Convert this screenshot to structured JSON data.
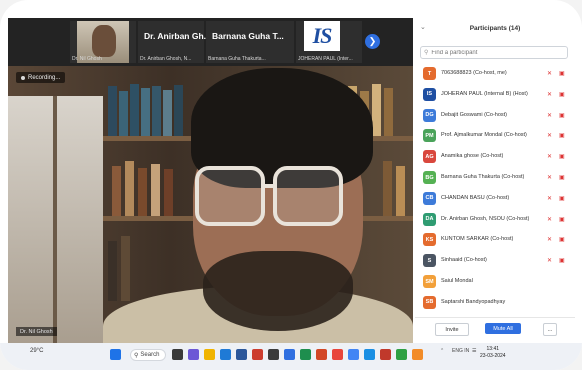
{
  "meeting": {
    "thumbnails": [
      {
        "name_overlay": "",
        "label": "Dr. Nil Ghosh"
      },
      {
        "name_overlay": "Dr. Anirban Gh...",
        "label": "Dr. Anirban Ghosh, N..."
      },
      {
        "name_overlay": "Barnana Guha T...",
        "label": "Barnana Guha Thakurta..."
      },
      {
        "name_overlay": "",
        "label": "JOHERAN PAUL (Inter..."
      }
    ],
    "recording_label": "Recording...",
    "self_label": "Dr. Nil Ghosh"
  },
  "participants_panel": {
    "title": "Participants (14)",
    "search_placeholder": "Find a participant",
    "participants": [
      {
        "initials": "T",
        "name": "7063688823 (Co-host, me)",
        "color": "#e46b2e"
      },
      {
        "initials": "IS",
        "name": "JOHERAN PAUL (Internal B) (Host)",
        "color": "#1f4fa2"
      },
      {
        "initials": "DG",
        "name": "Debajit Goswami (Co-host)",
        "color": "#3d7bd9"
      },
      {
        "initials": "PM",
        "name": "Prof. Ajmalkumar Mondal (Co-host)",
        "color": "#4aa35a"
      },
      {
        "initials": "AG",
        "name": "Anamika ghose (Co-host)",
        "color": "#d9473d"
      },
      {
        "initials": "BG",
        "name": "Barnana Guha Thakurta (Co-host)",
        "color": "#55b153"
      },
      {
        "initials": "CB",
        "name": "CHANDAN BASU (Co-host)",
        "color": "#3d7bd9"
      },
      {
        "initials": "DA",
        "name": "Dr. Anirban Ghosh, NSOU (Co-host)",
        "color": "#2f9c72"
      },
      {
        "initials": "KS",
        "name": "KUNTOM SARKAR (Co-host)",
        "color": "#e46b2e"
      },
      {
        "initials": "S",
        "name": "Sinhaaid (Co-host)",
        "color": "#4b5563"
      },
      {
        "initials": "SM",
        "name": "Saiul Mondal",
        "color": "#f2a03a"
      },
      {
        "initials": "SB",
        "name": "Saptarshi Bandyopadhyay",
        "color": "#e46b2e"
      }
    ],
    "invite_label": "Invite",
    "mute_all_label": "Mute All",
    "more_label": "..."
  },
  "taskbar": {
    "weather": "29°C",
    "search_label": "Search",
    "tray_lang": "ENG IN",
    "time": "13:41",
    "date": "23-03-2024"
  },
  "colors": {
    "accent": "#2f6fe0",
    "recording": "#d33b3b"
  }
}
